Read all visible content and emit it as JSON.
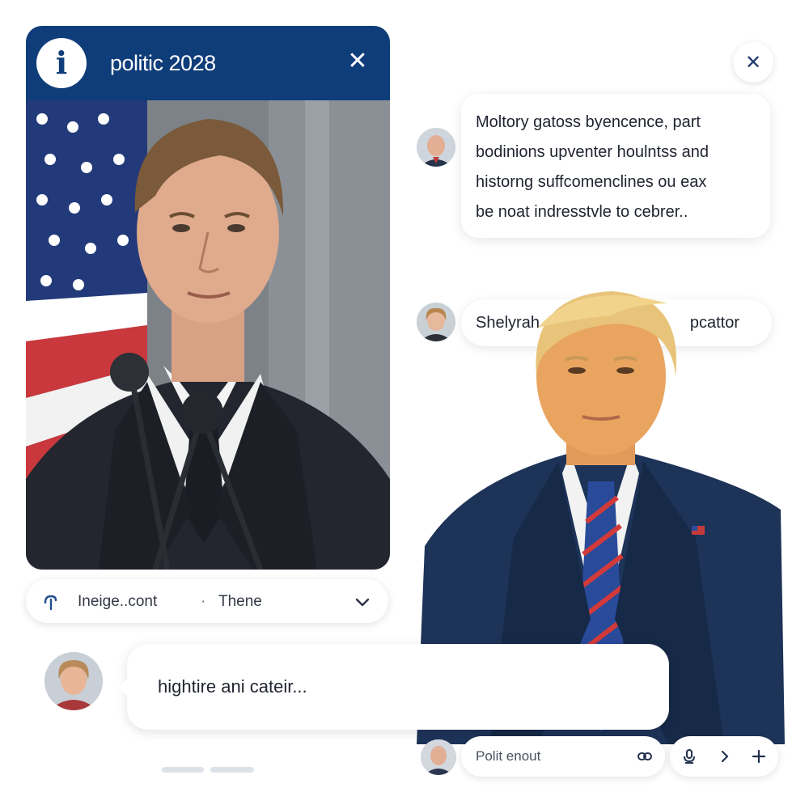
{
  "card": {
    "title": "politic 2028",
    "info_icon_glyph": "i",
    "close_glyph": "✕",
    "brand_color": "#0f3d7a"
  },
  "select_bar": {
    "value": "Ineige..cont",
    "separator": "·",
    "secondary": "Thene"
  },
  "top_close_glyph": "✕",
  "chat": {
    "message_lines": [
      "Moltory gatoss byencence, part",
      "bodinions upventer houlntss and",
      "historng suffcomenclines ou eax",
      "be noat indresstvle to cebrer.."
    ],
    "second_message_left": "Shelyrah",
    "second_message_right": "pcattor",
    "long_message": "hightire ani cateir..."
  },
  "composer": {
    "placeholder": "Polit enout"
  },
  "icons": {
    "info": "info-icon",
    "close": "close-icon",
    "prefix": "filter-icon",
    "chevron": "chevron-down-icon",
    "link": "link-icon",
    "mic": "microphone-icon",
    "next": "chevron-right-icon",
    "add": "plus-icon"
  }
}
